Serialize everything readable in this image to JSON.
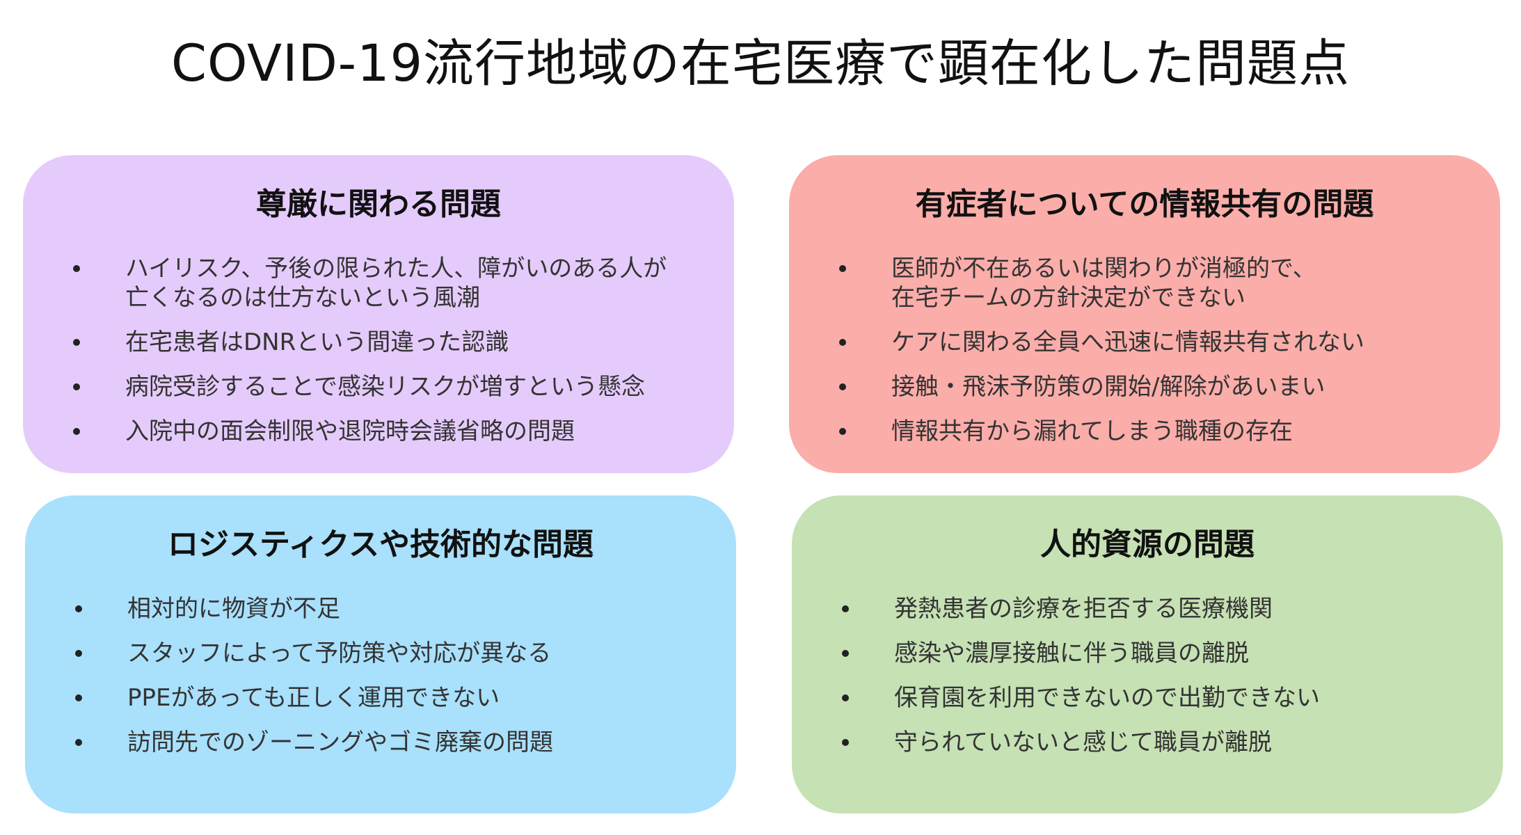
{
  "title": "COVID-19流行地域の在宅医療で顕在化した問題点",
  "colors": {
    "purple": "#E5CBFB",
    "red": "#FBADA9",
    "blue": "#A9E0FC",
    "green": "#C6E1B4"
  },
  "panels": [
    {
      "heading": "尊厳に関わる問題",
      "items": [
        "ハイリスク、予後の限られた人、障がいのある人が\n亡くなるのは仕方ないという風潮",
        "在宅患者はDNRという間違った認識",
        "病院受診することで感染リスクが増すという懸念",
        "入院中の面会制限や退院時会議省略の問題"
      ]
    },
    {
      "heading": "有症者についての情報共有の問題",
      "items": [
        "医師が不在あるいは関わりが消極的で、\n在宅チームの方針決定ができない",
        "ケアに関わる全員へ迅速に情報共有されない",
        "接触・飛沫予防策の開始/解除があいまい",
        "情報共有から漏れてしまう職種の存在"
      ]
    },
    {
      "heading": "ロジスティクスや技術的な問題",
      "items": [
        "相対的に物資が不足",
        "スタッフによって予防策や対応が異なる",
        "PPEがあっても正しく運用できない",
        "訪問先でのゾーニングやゴミ廃棄の問題"
      ]
    },
    {
      "heading": "人的資源の問題",
      "items": [
        "発熱患者の診療を拒否する医療機関",
        "感染や濃厚接触に伴う職員の離脱",
        "保育園を利用できないので出勤できない",
        "守られていないと感じて職員が離脱"
      ]
    }
  ]
}
